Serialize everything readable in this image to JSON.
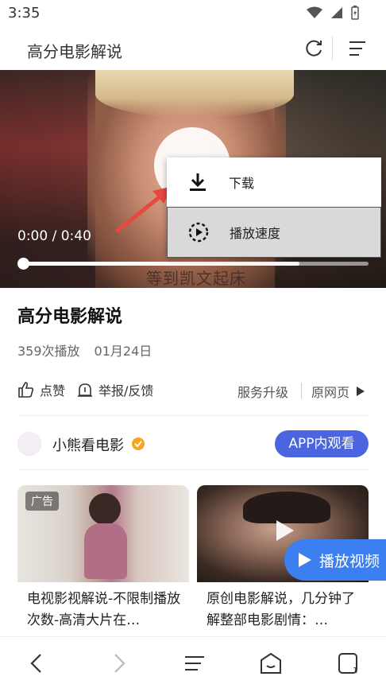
{
  "status": {
    "time": "3:35"
  },
  "header": {
    "title": "高分电影解说"
  },
  "video": {
    "time_display": "0:00 / 0:40",
    "progress_fraction": 0.8,
    "subtitle": "等到凯文起床"
  },
  "menu": {
    "items": [
      {
        "label": "下载",
        "icon": "download-icon"
      },
      {
        "label": "播放速度",
        "icon": "playback-speed-icon"
      }
    ]
  },
  "info": {
    "title": "高分电影解说",
    "plays": "359次播放",
    "date": "01月24日"
  },
  "actions": {
    "like": "点赞",
    "report": "举报/反馈",
    "upgrade": "服务升级",
    "original": "原网页"
  },
  "author": {
    "name": "小熊看电影",
    "app_button": "APP内观看"
  },
  "cards": [
    {
      "badge": "广告",
      "title": "电视影视解说-不限制播放次数-高清大片在…"
    },
    {
      "title": "原创电影解说，几分钟了解整部电影剧情：…"
    }
  ],
  "floating_button": {
    "label": "播放视频"
  },
  "colors": {
    "accent": "#4b64e0",
    "play_button": "#3b7ff0",
    "arrow": "#e8483f"
  }
}
